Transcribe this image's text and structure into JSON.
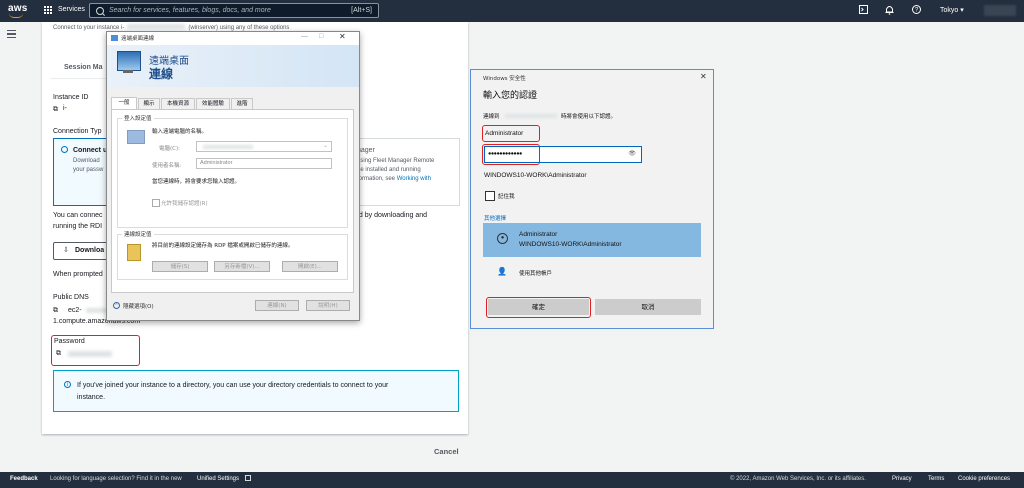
{
  "topnav": {
    "logo": "aws",
    "services_label": "Services",
    "search_placeholder": "Search for services, features, blogs, docs, and more",
    "search_shortcut": "[Alt+S]",
    "region": "Tokyo ▾",
    "icons": [
      "cloudshell-icon",
      "bell-icon",
      "help-icon"
    ]
  },
  "connect": {
    "intro": "Connect to your instance i-",
    "intro_suffix": "(winserver) using any of these options",
    "tab_session": "Session Ma",
    "instance_id_label": "Instance ID",
    "instance_id_prefix": "i-",
    "connection_type_label": "Connection Typ",
    "option_title": "Connect u",
    "option_line1": "Download",
    "option_line2": "your passw",
    "fleet_title": "nager",
    "fleet_line1": "asing Fleet Manager Remote",
    "fleet_line2": "be installed and running",
    "fleet_line3": "formation, see",
    "fleet_link": "Working with",
    "para1_a": "You can connec",
    "para1_b": "nd by downloading and",
    "para1_c": "running the RDI",
    "download_label": "Downloa",
    "prompted": "When prompted",
    "public_dns_label": "Public DNS",
    "public_dns_a": "ec2-",
    "public_dns_b": "1.compute.amazonaws.com",
    "password_label": "Password",
    "info_text_1": "If you've joined your instance to a directory, you can use your directory credentials to connect to your",
    "info_text_2": "instance.",
    "cancel_label": "Cancel"
  },
  "rdp": {
    "window_title": "遠端桌面連線",
    "banner_line1": "遠端桌面",
    "banner_line2": "連線",
    "tabs": [
      "一般",
      "顯示",
      "本機資源",
      "效能體驗",
      "進階"
    ],
    "login_group": "登入設定值",
    "login_prompt": "輸入遠端電腦的名稱。",
    "computer_label": "電腦(C):",
    "username_label": "使用者名稱:",
    "username_value": "Administrator",
    "credential_note": "當您連線時，將會要求您輸入認證。",
    "allow_save": "允許我儲存認證(R)",
    "conn_group": "連線設定值",
    "conn_note": "將目前的連線設定儲存為 RDP 檔案或開啟已儲存的連線。",
    "save_btn": "儲存(S)",
    "saveas_btn": "另存新檔(V)...",
    "open_btn": "開啟(E)...",
    "hide_options": "隱藏選項(O)",
    "connect_btn": "連線(N)",
    "help_btn": "說明(H)"
  },
  "winsec": {
    "title": "Windows 安全性",
    "heading": "輸入您的認證",
    "subtitle_a": "連線到 ",
    "subtitle_b": "時將會使用以下認證。",
    "username_value": "Administrator",
    "password_mask": "●●●●●●●●●●●●",
    "domain_user": "WINDOWS10-WORK\\Administrator",
    "remember": "記住我",
    "more_choices": "其他選擇",
    "account_name": "Administrator",
    "account_domain": "WINDOWS10-WORK\\Administrator",
    "other_account": "使用其他帳戶",
    "ok": "確定",
    "cancel": "取消"
  },
  "footer": {
    "feedback": "Feedback",
    "lang_prompt": "Looking for language selection? Find it in the new",
    "unified": "Unified Settings",
    "copyright": "© 2022, Amazon Web Services, Inc. or its affiliates.",
    "privacy": "Privacy",
    "terms": "Terms",
    "cookies": "Cookie preferences"
  },
  "colors": {
    "nav": "#232f3e",
    "accent": "#0073bb",
    "highlight": "#e02121",
    "winsec_selected": "#84b8e0"
  }
}
